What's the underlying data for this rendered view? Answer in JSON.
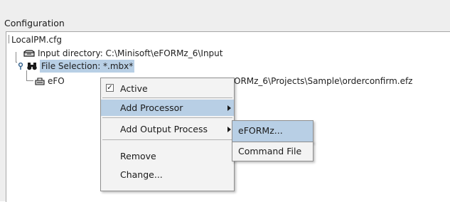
{
  "panel": {
    "title": "Configuration"
  },
  "tree": {
    "root": "LocalPM.cfg",
    "input_directory": "Input directory: C:\\Minisoft\\eFORMz_6\\Input",
    "file_selection": "File Selection: *.mbx*",
    "processor_prefix": "eFO",
    "processor_path_suffix": "ORMz_6\\Projects\\Sample\\orderconfirm.efz"
  },
  "context_menu": {
    "active_label": "Active",
    "active_checked": true,
    "add_processor": "Add Processor",
    "add_output_process": "Add Output Process",
    "remove": "Remove",
    "change": "Change..."
  },
  "submenu": {
    "eformz": "eFORMz...",
    "command_file": "Command File"
  },
  "colors": {
    "selection": "#b8cfe5",
    "menu_bg": "#f3f3f3",
    "panel_bg": "#eeeeee"
  },
  "icons": {
    "input_directory": "tray-icon",
    "file_selection": "binoculars-icon",
    "processor": "printer-icon"
  }
}
